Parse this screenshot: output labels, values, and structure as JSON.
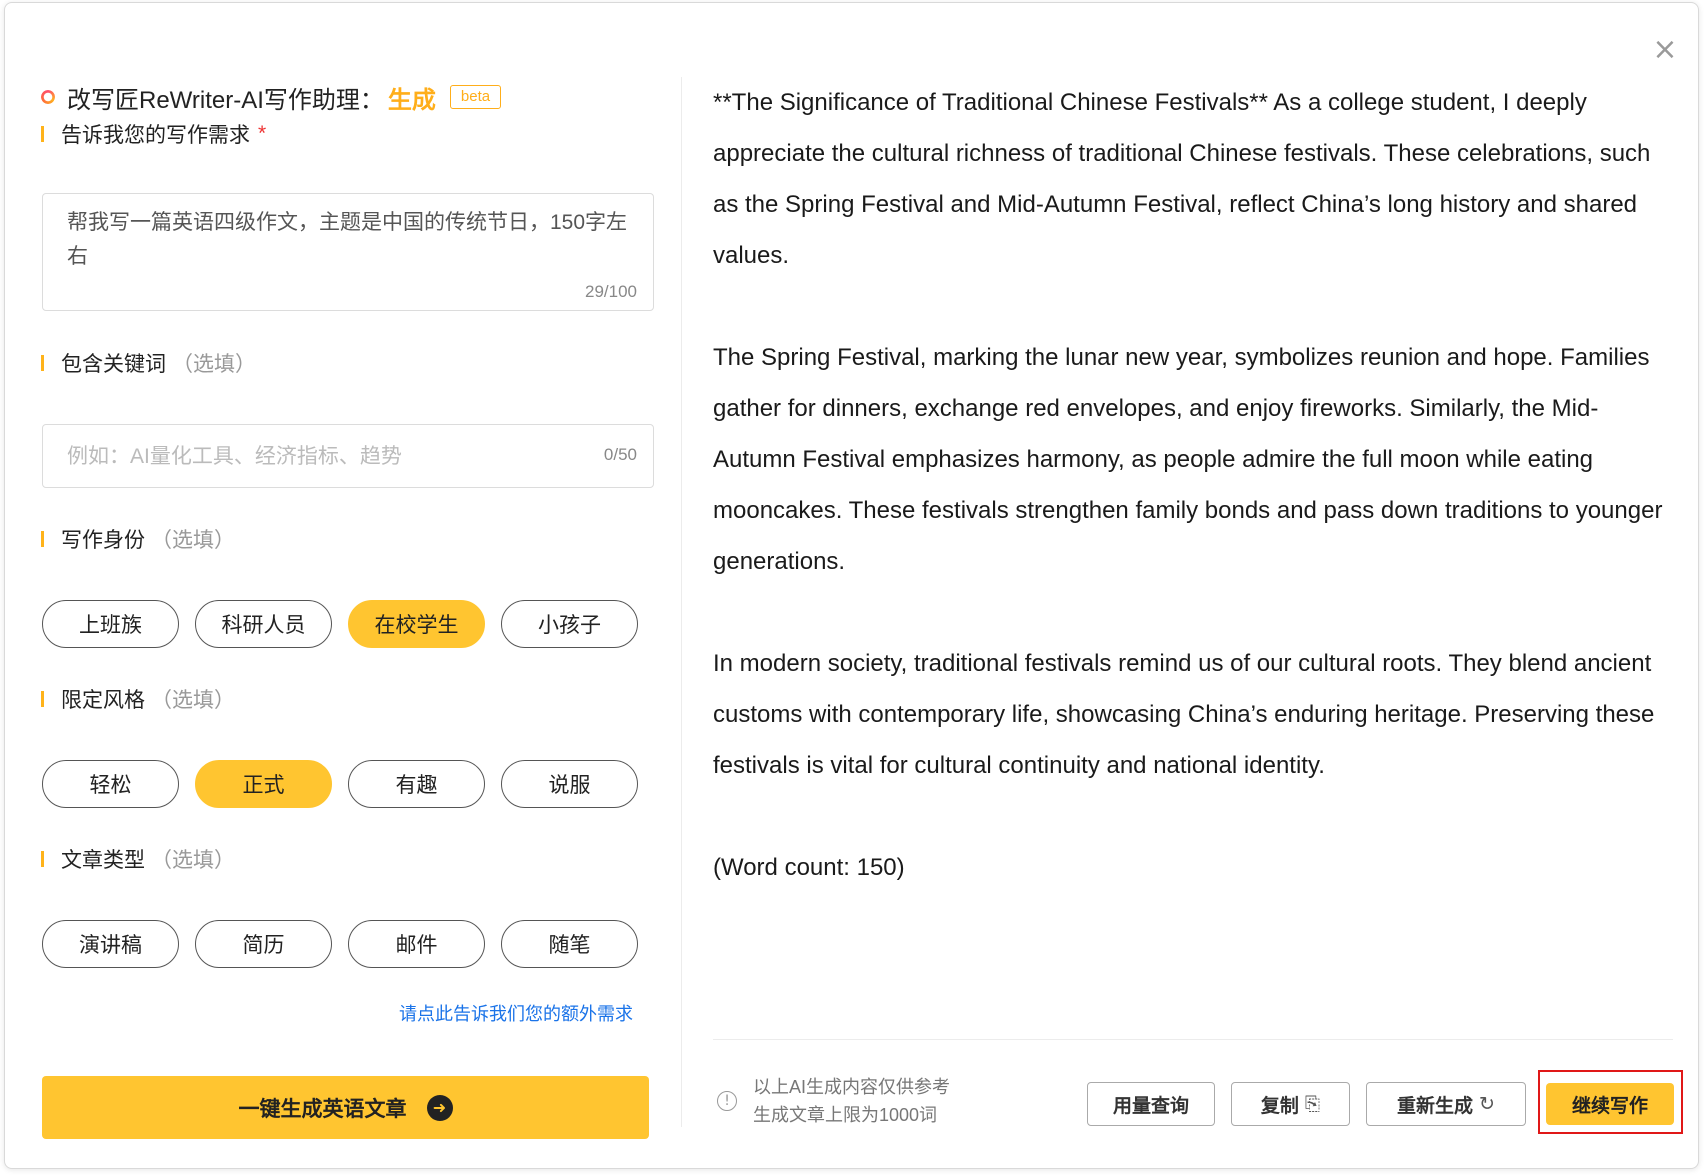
{
  "app": {
    "title": "改写匠ReWriter-AI写作助理：",
    "mode": "生成",
    "badge": "beta"
  },
  "requirement": {
    "label": "告诉我您的写作需求",
    "required_mark": "*",
    "value": "帮我写一篇英语四级作文，主题是中国的传统节日，150字左右",
    "counter": "29/100"
  },
  "keywords": {
    "label": "包含关键词",
    "optional": "（选填）",
    "placeholder": "例如：AI量化工具、经济指标、趋势",
    "counter": "0/50"
  },
  "identity": {
    "label": "写作身份",
    "optional": "（选填）",
    "options": [
      "上班族",
      "科研人员",
      "在校学生",
      "小孩子"
    ],
    "selected": "在校学生"
  },
  "style": {
    "label": "限定风格",
    "optional": "（选填）",
    "options": [
      "轻松",
      "正式",
      "有趣",
      "说服"
    ],
    "selected": "正式"
  },
  "article_type": {
    "label": "文章类型",
    "optional": "（选填）",
    "options": [
      "演讲稿",
      "简历",
      "邮件",
      "随笔"
    ]
  },
  "extra_link": "请点此告诉我们您的额外需求",
  "generate_button": "一键生成英语文章",
  "article": {
    "paragraphs": [
      "**The Significance of Traditional Chinese Festivals**  As a college student, I deeply appreciate the cultural richness of traditional Chinese festivals. These celebrations, such as the Spring Festival and Mid-Autumn Festival, reflect China’s long history and shared values.",
      "The Spring Festival, marking the lunar new year, symbolizes reunion and hope. Families gather for dinners, exchange red envelopes, and enjoy fireworks. Similarly, the Mid-Autumn Festival emphasizes harmony, as people admire the full moon while eating mooncakes. These festivals strengthen family bonds and pass down traditions to younger generations.",
      "In modern society, traditional festivals remind us of our cultural roots. They blend ancient customs with contemporary life, showcasing China’s enduring heritage. Preserving these festivals is vital for cultural continuity and national identity.",
      "(Word count: 150)"
    ]
  },
  "notice": {
    "line1": "以上AI生成内容仅供参考",
    "line2": "生成文章上限为1000词"
  },
  "actions": {
    "usage": "用量查询",
    "copy": "复制",
    "regenerate": "重新生成",
    "continue": "继续写作"
  },
  "icons": {
    "close": "close-icon",
    "ring": "ring-icon",
    "info": "info-icon",
    "copy": "copy-icon",
    "refresh": "refresh-icon",
    "arrow": "arrow-right-icon"
  },
  "colors": {
    "accent": "#ffc530",
    "accent_text": "#ffae1a",
    "link": "#1a73e8",
    "required": "#ee3333",
    "highlight": "#e01818"
  }
}
